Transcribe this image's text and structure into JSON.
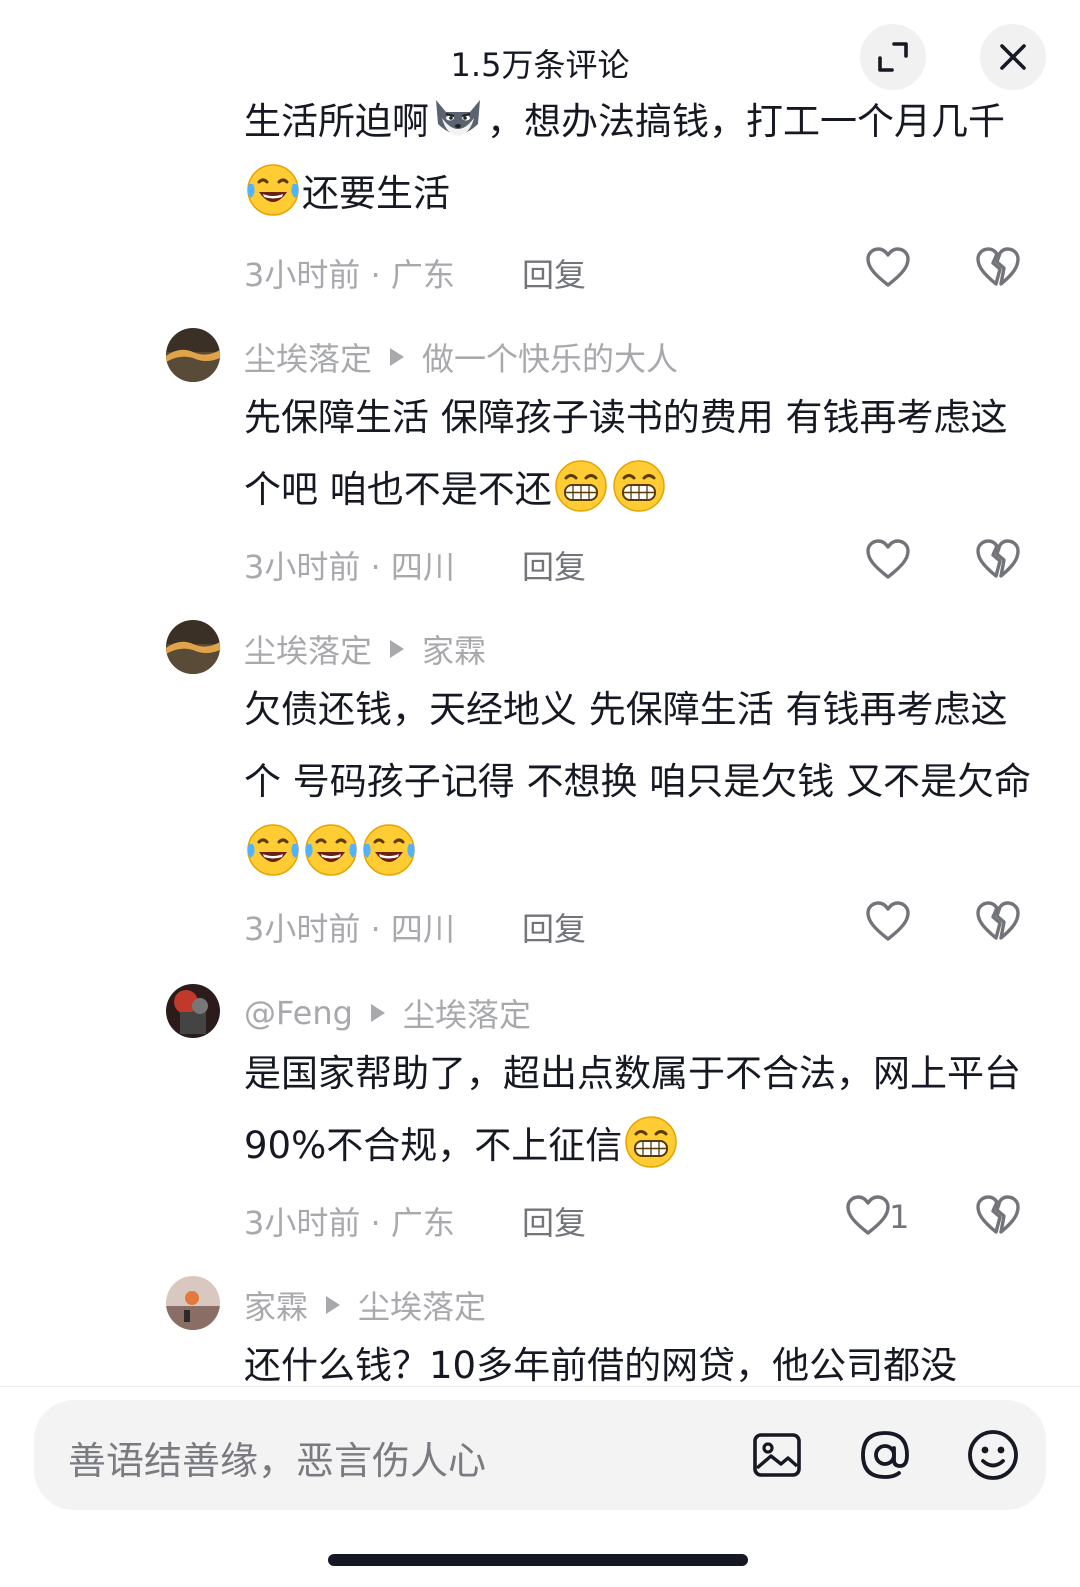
{
  "header": {
    "title": "1.5万条评论",
    "expand_icon": "expand-icon",
    "close_icon": "close-icon"
  },
  "comments": [
    {
      "text_parts": [
        "生活所迫啊",
        "，想办法搞钱，打工一个月几千",
        "还要生活"
      ],
      "emojis": [
        "fox-emoji",
        "laughing-crying-emoji"
      ],
      "time_location": "3小时前 · 广东",
      "reply_label": "回复"
    },
    {
      "author": "尘埃落定",
      "reply_to": "做一个快乐的大人",
      "text_parts": [
        "先保障生活 保障孩子读书的费用 有钱再考虑这个吧 咱也不是不还"
      ],
      "emojis": [
        "grin-emoji",
        "grin-emoji"
      ],
      "time_location": "3小时前 · 四川",
      "reply_label": "回复"
    },
    {
      "author": "尘埃落定",
      "reply_to": "家霖",
      "text_parts": [
        "欠债还钱，天经地义 先保障生活 有钱再考虑这个 号码孩子记得 不想换 咱只是欠钱 又不是欠命"
      ],
      "emojis": [
        "laughing-crying-emoji",
        "laughing-crying-emoji",
        "laughing-crying-emoji"
      ],
      "time_location": "3小时前 · 四川",
      "reply_label": "回复"
    },
    {
      "author": "@Feng",
      "reply_to": "尘埃落定",
      "text_parts": [
        "是国家帮助了，超出点数属于不合法，网上平台90%不合规，不上征信"
      ],
      "emojis": [
        "grin-emoji"
      ],
      "time_location": "3小时前 · 广东",
      "reply_label": "回复",
      "like_count": "1"
    },
    {
      "author": "家霖",
      "reply_to": "尘埃落定",
      "text_parts": [
        "还什么钱？10多年前借的网贷，他公司都没"
      ]
    }
  ],
  "input_bar": {
    "placeholder": "善语结善缘，恶言伤人心",
    "icons": [
      "image-icon",
      "at-icon",
      "emoji-icon"
    ]
  },
  "colors": {
    "text_primary": "#161823",
    "text_secondary": "#a8a9ad",
    "background": "#ffffff",
    "input_background": "#f3f3f4"
  }
}
